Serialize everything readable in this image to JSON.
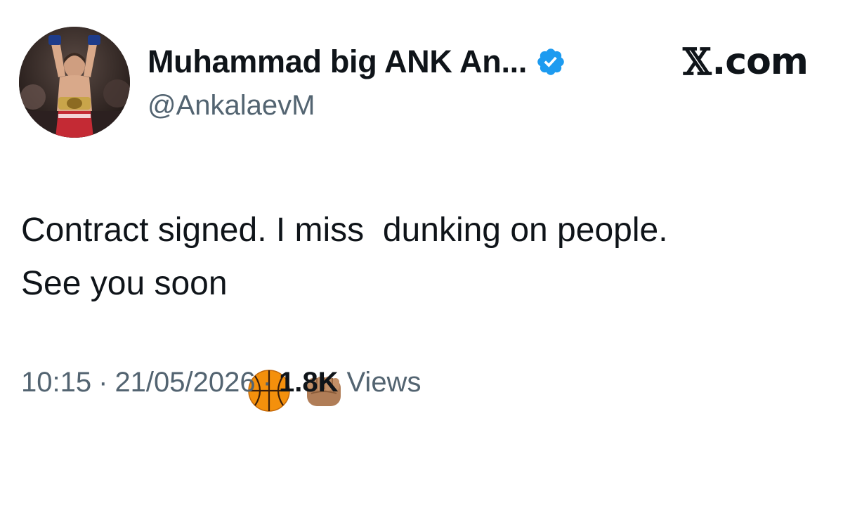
{
  "author": {
    "display_name": "Muhammad big ANK An...",
    "handle": "@AnkalaevM",
    "verified": true,
    "verified_color": "#1d9bf0"
  },
  "brand": {
    "x_glyph": "𝕏",
    "domain": ".com"
  },
  "tweet": {
    "line1": "Contract signed. I miss  dunking on people.",
    "line2": "See you soon ",
    "emojis": [
      "basketball-emoji",
      "fist-emoji"
    ]
  },
  "meta": {
    "time": "10:15",
    "separator": "·",
    "date": "21/05/2026",
    "views_count": "1.8K",
    "views_label": "Views"
  },
  "colors": {
    "text_primary": "#0f1419",
    "text_secondary": "#536471",
    "background": "#ffffff"
  }
}
